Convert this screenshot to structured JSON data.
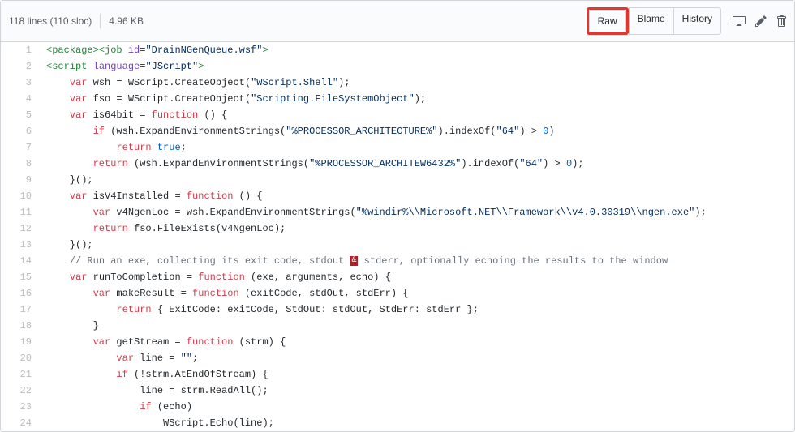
{
  "header": {
    "lines_info": "118 lines (110 sloc)",
    "size_info": "4.96 KB",
    "buttons": {
      "raw": "Raw",
      "blame": "Blame",
      "history": "History"
    }
  },
  "icons": {
    "desktop": "desktop-icon",
    "pencil": "pencil-icon",
    "trash": "trash-icon"
  },
  "code": [
    {
      "n": 1,
      "html": "<span class='pl-ent'>&lt;package&gt;</span><span class='pl-ent'>&lt;job</span> <span class='pl-e'>id</span>=<span class='pl-s'>\"DrainNGenQueue.wsf\"</span><span class='pl-ent'>&gt;</span>"
    },
    {
      "n": 2,
      "html": "<span class='pl-ent'>&lt;script</span> <span class='pl-e'>language</span>=<span class='pl-s'>\"JScript\"</span><span class='pl-ent'>&gt;</span>"
    },
    {
      "n": 3,
      "html": "    <span class='pl-k'>var</span> wsh = WScript.CreateObject(<span class='pl-s'>\"WScript.Shell\"</span>);"
    },
    {
      "n": 4,
      "html": "    <span class='pl-k'>var</span> fso = WScript.CreateObject(<span class='pl-s'>\"Scripting.FileSystemObject\"</span>);"
    },
    {
      "n": 5,
      "html": "    <span class='pl-k'>var</span> is64bit = <span class='pl-k'>function</span> () {"
    },
    {
      "n": 6,
      "html": "        <span class='pl-k'>if</span> (wsh.ExpandEnvironmentStrings(<span class='pl-s'>\"%PROCESSOR_ARCHITECTURE%\"</span>).indexOf(<span class='pl-s'>\"64\"</span>) &gt; <span class='pl-c1'>0</span>)"
    },
    {
      "n": 7,
      "html": "            <span class='pl-k'>return</span> <span class='pl-c1'>true</span>;"
    },
    {
      "n": 8,
      "html": "        <span class='pl-k'>return</span> (wsh.ExpandEnvironmentStrings(<span class='pl-s'>\"%PROCESSOR_ARCHITEW6432%\"</span>).indexOf(<span class='pl-s'>\"64\"</span>) &gt; <span class='pl-c1'>0</span>);"
    },
    {
      "n": 9,
      "html": "    }();"
    },
    {
      "n": 10,
      "html": "    <span class='pl-k'>var</span> isV4Installed = <span class='pl-k'>function</span> () {"
    },
    {
      "n": 11,
      "html": "        <span class='pl-k'>var</span> v4NgenLoc = wsh.ExpandEnvironmentStrings(<span class='pl-s'>\"%windir%\\\\Microsoft.NET\\\\Framework\\\\v4.0.30319\\\\ngen.exe\"</span>);"
    },
    {
      "n": 12,
      "html": "        <span class='pl-k'>return</span> fso.FileExists(v4NgenLoc);"
    },
    {
      "n": 13,
      "html": "    }();"
    },
    {
      "n": 14,
      "html": "    <span class='pl-c'>// Run an exe, collecting its exit code, stdout <span class='red-box'>&amp;</span> stderr, optionally echoing the results to the window</span>"
    },
    {
      "n": 15,
      "html": "    <span class='pl-k'>var</span> runToCompletion = <span class='pl-k'>function</span> (exe, arguments, echo) {"
    },
    {
      "n": 16,
      "html": "        <span class='pl-k'>var</span> makeResult = <span class='pl-k'>function</span> (exitCode, stdOut, stdErr) {"
    },
    {
      "n": 17,
      "html": "            <span class='pl-k'>return</span> { ExitCode: exitCode, StdOut: stdOut, StdErr: stdErr };"
    },
    {
      "n": 18,
      "html": "        }"
    },
    {
      "n": 19,
      "html": "        <span class='pl-k'>var</span> getStream = <span class='pl-k'>function</span> (strm) {"
    },
    {
      "n": 20,
      "html": "            <span class='pl-k'>var</span> line = <span class='pl-s'>\"\"</span>;"
    },
    {
      "n": 21,
      "html": "            <span class='pl-k'>if</span> (!strm.AtEndOfStream) {"
    },
    {
      "n": 22,
      "html": "                line = strm.ReadAll();"
    },
    {
      "n": 23,
      "html": "                <span class='pl-k'>if</span> (echo)"
    },
    {
      "n": 24,
      "html": "                    WScript.Echo(line);"
    }
  ]
}
